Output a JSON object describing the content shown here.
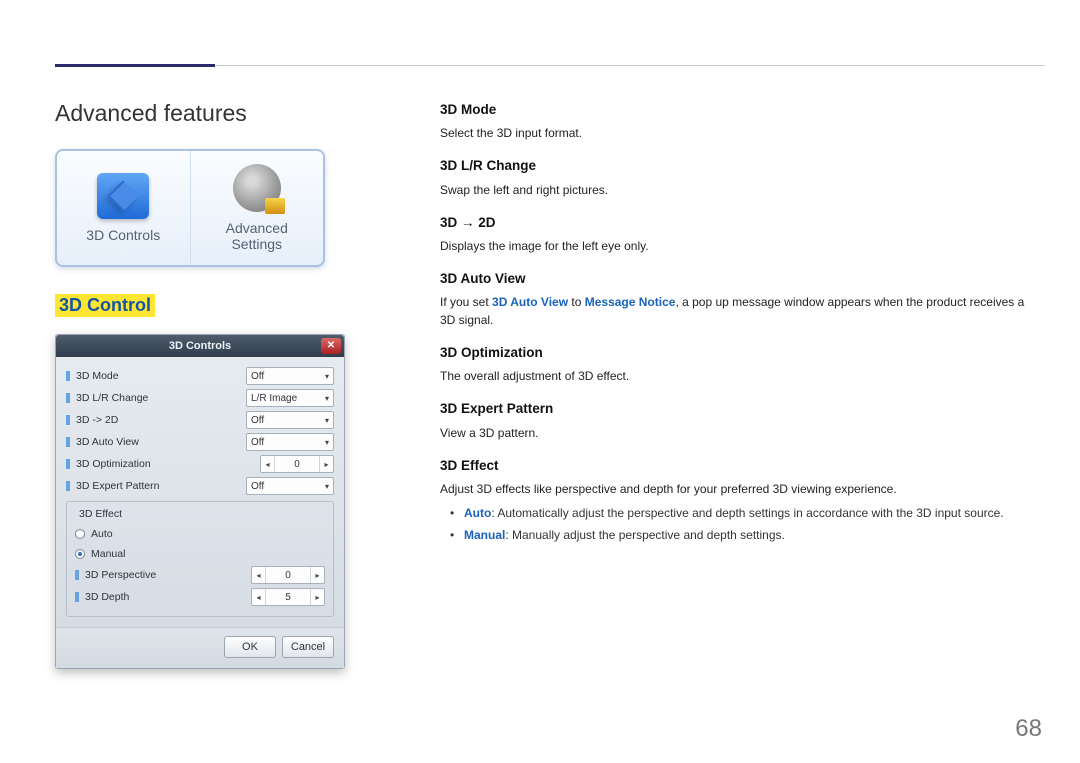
{
  "page_title": "Advanced features",
  "page_number": "68",
  "tiles": {
    "controls_label": "3D Controls",
    "advanced_label_line1": "Advanced",
    "advanced_label_line2": "Settings"
  },
  "section_heading": "3D Control",
  "dialog": {
    "title": "3D Controls",
    "close_glyph": "✕",
    "rows": [
      {
        "label": "3D Mode",
        "value": "Off"
      },
      {
        "label": "3D L/R Change",
        "value": "L/R Image"
      },
      {
        "label": "3D -> 2D",
        "value": "Off"
      },
      {
        "label": "3D Auto View",
        "value": "Off"
      },
      {
        "label": "3D Optimization",
        "value": "0"
      },
      {
        "label": "3D Expert Pattern",
        "value": "Off"
      }
    ],
    "effect_group_title": "3D Effect",
    "radio_auto": "Auto",
    "radio_manual": "Manual",
    "perspective_label": "3D Perspective",
    "perspective_value": "0",
    "depth_label": "3D Depth",
    "depth_value": "5",
    "ok": "OK",
    "cancel": "Cancel"
  },
  "content": {
    "h_mode": "3D Mode",
    "p_mode": "Select the 3D input format.",
    "h_lr": "3D L/R Change",
    "p_lr": "Swap the left and right pictures.",
    "h_2d": "3D → 2D",
    "p_2d": "Displays the image for the left eye only.",
    "h_autoview": "3D Auto View",
    "p_autoview_pre": "If you set ",
    "p_autoview_kw1": "3D Auto View",
    "p_autoview_mid": " to ",
    "p_autoview_kw2": "Message Notice",
    "p_autoview_post": ", a pop up message window appears when the product receives a 3D signal.",
    "h_opt": "3D Optimization",
    "p_opt": "The overall adjustment of 3D effect.",
    "h_expert": "3D Expert Pattern",
    "p_expert": "View a 3D pattern.",
    "h_effect": "3D Effect",
    "p_effect": "Adjust 3D effects like perspective and depth for your preferred 3D viewing experience.",
    "li_auto_kw": "Auto",
    "li_auto_text": ": Automatically adjust the perspective and depth settings in accordance with the 3D input source.",
    "li_manual_kw": "Manual",
    "li_manual_text": ": Manually adjust the perspective and depth settings."
  }
}
